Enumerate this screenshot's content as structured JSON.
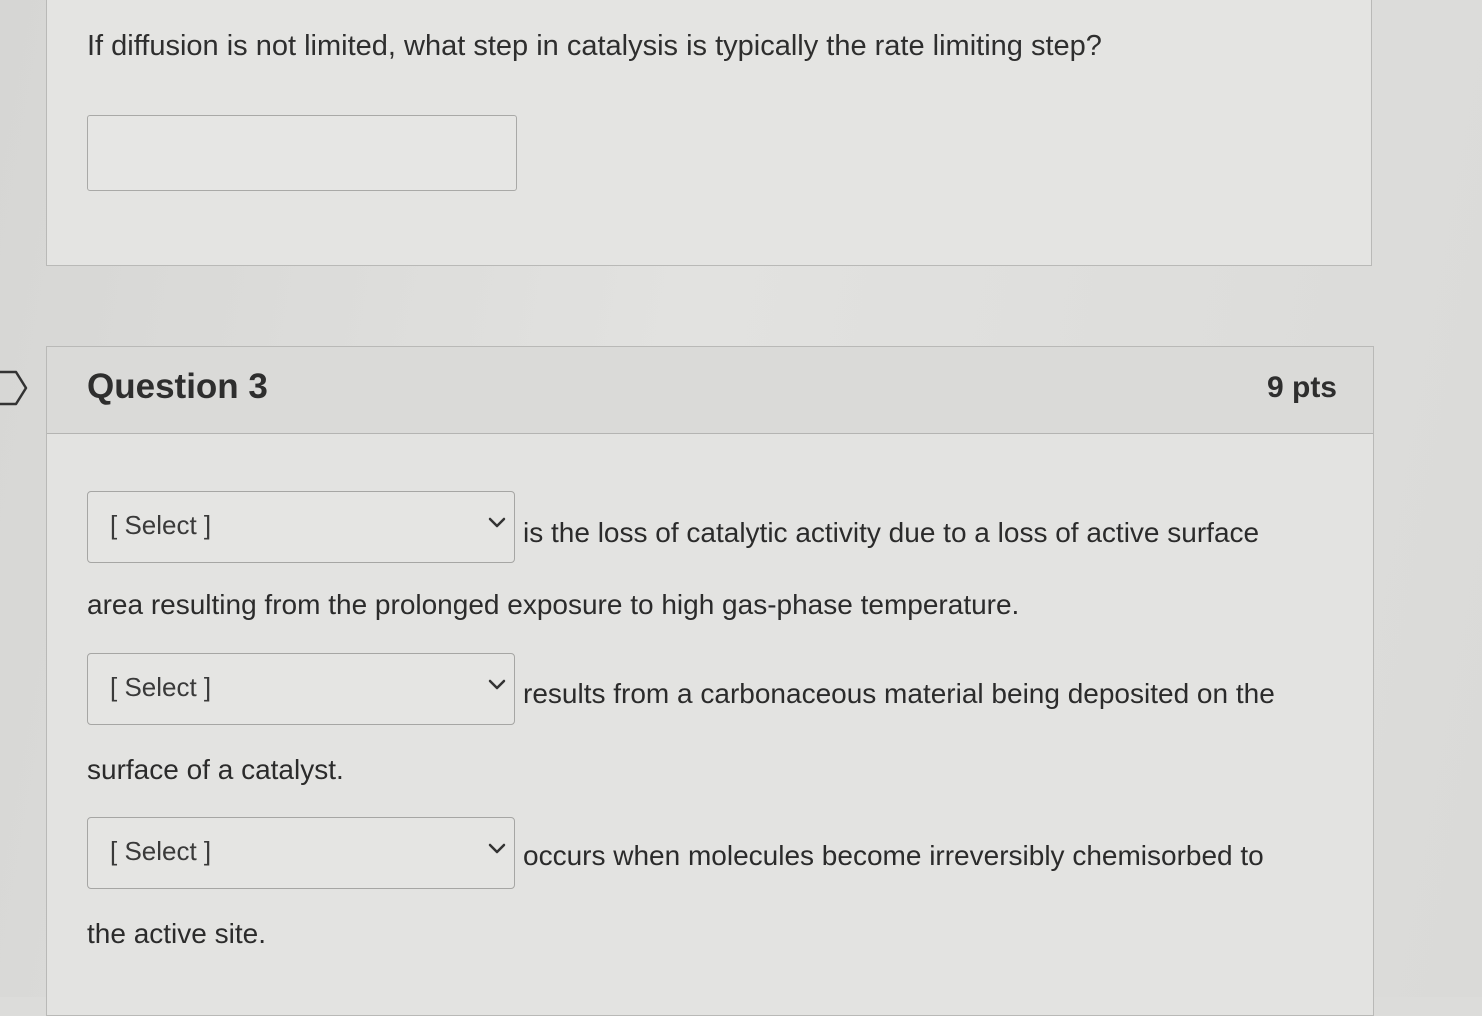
{
  "previous_question": {
    "text": "If diffusion is not limited, what step in catalysis is typically the rate limiting step?",
    "answer_value": ""
  },
  "question3": {
    "title": "Question 3",
    "points": "9 pts",
    "items": [
      {
        "select_label": "[ Select ]",
        "inline_text": "is the loss of catalytic activity due to a loss of active surface",
        "continued_text": "area resulting from the prolonged exposure to high gas-phase temperature."
      },
      {
        "select_label": "[ Select ]",
        "inline_text": "results from a carbonaceous material being deposited on the",
        "continued_text": "surface of a catalyst."
      },
      {
        "select_label": "[ Select ]",
        "inline_text": "occurs when molecules become irreversibly chemisorbed to",
        "continued_text": "the active site."
      }
    ]
  },
  "icons": {
    "dropdown": "chevron-down-icon",
    "side_marker": "arrow-right-outline-icon"
  }
}
